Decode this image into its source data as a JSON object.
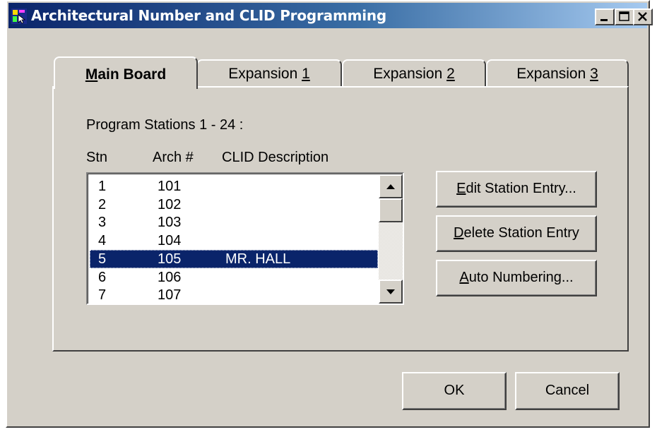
{
  "window": {
    "title": "Architectural Number and CLID Programming",
    "controls": [
      "minimize-icon",
      "maximize-icon",
      "close-icon"
    ]
  },
  "tabs": [
    {
      "pre": "",
      "key": "M",
      "post": "ain Board",
      "active": true
    },
    {
      "pre": "Expansion ",
      "key": "1",
      "post": "",
      "active": false
    },
    {
      "pre": "Expansion ",
      "key": "2",
      "post": "",
      "active": false
    },
    {
      "pre": "Expansion ",
      "key": "3",
      "post": "",
      "active": false
    }
  ],
  "panel": {
    "heading": "Program Stations 1 - 24 :",
    "columns": {
      "stn": "Stn",
      "arch": "Arch #",
      "desc": "CLID Description"
    }
  },
  "stations": [
    {
      "stn": "1",
      "arch": "101",
      "desc": ""
    },
    {
      "stn": "2",
      "arch": "102",
      "desc": ""
    },
    {
      "stn": "3",
      "arch": "103",
      "desc": ""
    },
    {
      "stn": "4",
      "arch": "104",
      "desc": ""
    },
    {
      "stn": "5",
      "arch": "105",
      "desc": "MR. HALL",
      "selected": true
    },
    {
      "stn": "6",
      "arch": "106",
      "desc": ""
    },
    {
      "stn": "7",
      "arch": "107",
      "desc": ""
    }
  ],
  "actions": {
    "edit": {
      "key": "E",
      "rest": "dit Station Entry..."
    },
    "delete": {
      "key": "D",
      "rest": "elete Station Entry"
    },
    "auto": {
      "key": "A",
      "rest": "uto Numbering..."
    }
  },
  "footer": {
    "ok": "OK",
    "cancel": "Cancel"
  },
  "colors": {
    "face": "#d4d0c8",
    "title_active": "#0a246a",
    "selection": "#0a246a"
  }
}
